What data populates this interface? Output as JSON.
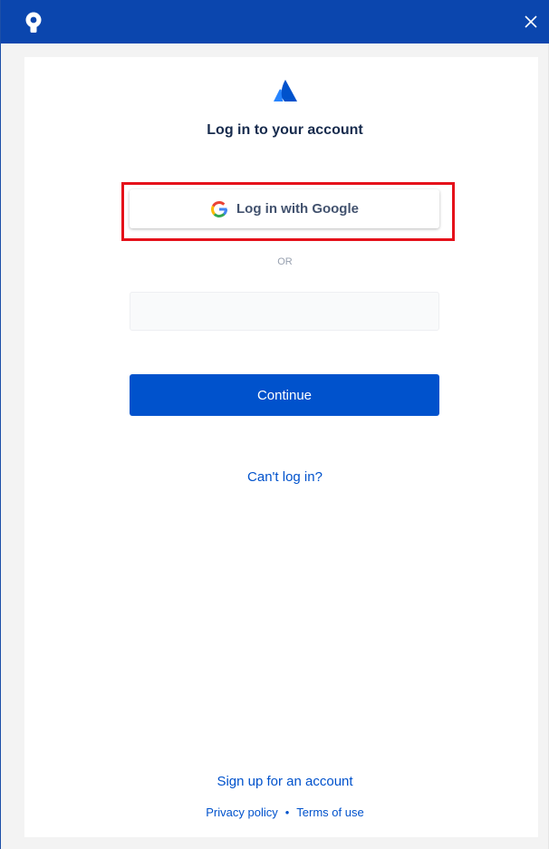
{
  "titlebar": {
    "app_icon": "sourcetree-icon",
    "close_icon": "close-icon",
    "background": "#0b46ae"
  },
  "login": {
    "brand_icon": "atlassian-icon",
    "heading": "Log in to your account",
    "google_button_label": "Log in with Google",
    "google_icon": "google-icon",
    "or_label": "OR",
    "email_value": "",
    "continue_label": "Continue",
    "cant_login_link": "Can't log in?",
    "signup_link": "Sign up for an account",
    "privacy_link": "Privacy policy",
    "separator": "•",
    "terms_link": "Terms of use"
  },
  "colors": {
    "primary": "#0052cc",
    "heading": "#172b4d",
    "highlight": "#e5111a"
  }
}
